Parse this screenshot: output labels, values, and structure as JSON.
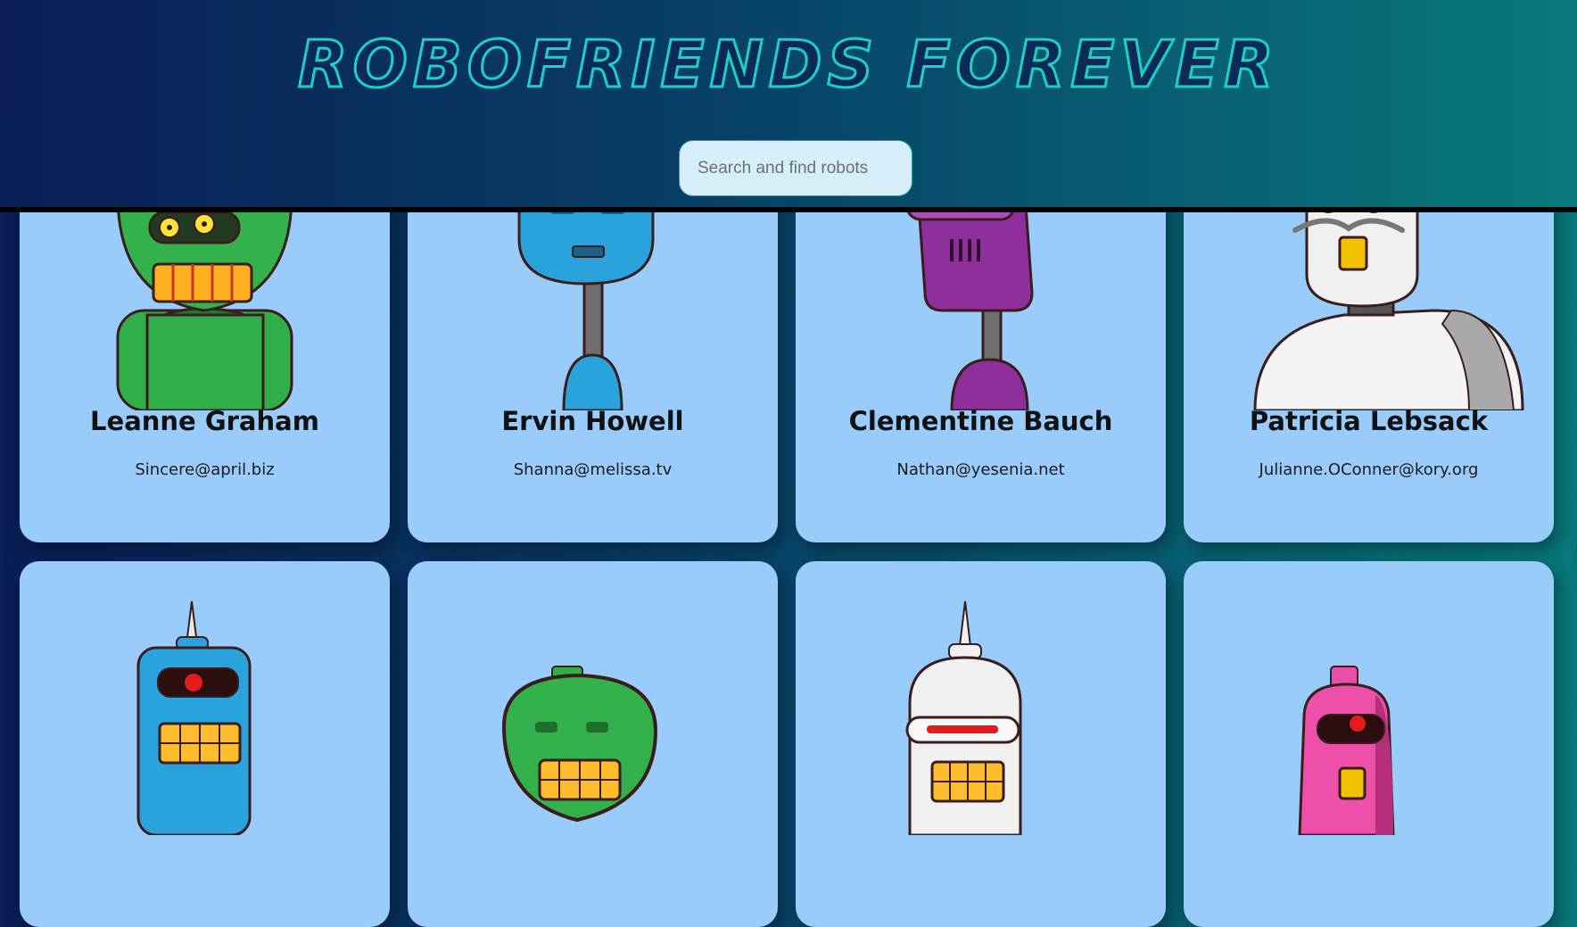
{
  "app": {
    "title": "ROBOFRIENDS FOREVER"
  },
  "search": {
    "placeholder": "Search and find robots"
  },
  "robots": [
    {
      "name": "Leanne Graham",
      "email": "Sincere@april.biz"
    },
    {
      "name": "Ervin Howell",
      "email": "Shanna@melissa.tv"
    },
    {
      "name": "Clementine Bauch",
      "email": "Nathan@yesenia.net"
    },
    {
      "name": "Patricia Lebsack",
      "email": "Julianne.OConner@kory.org"
    },
    {
      "name": "",
      "email": ""
    },
    {
      "name": "",
      "email": ""
    },
    {
      "name": "",
      "email": ""
    },
    {
      "name": "",
      "email": ""
    }
  ],
  "colors": {
    "title_outline": "#1cd0c8",
    "card_bg": "#99cbfb",
    "search_bg": "#d5eef7"
  }
}
